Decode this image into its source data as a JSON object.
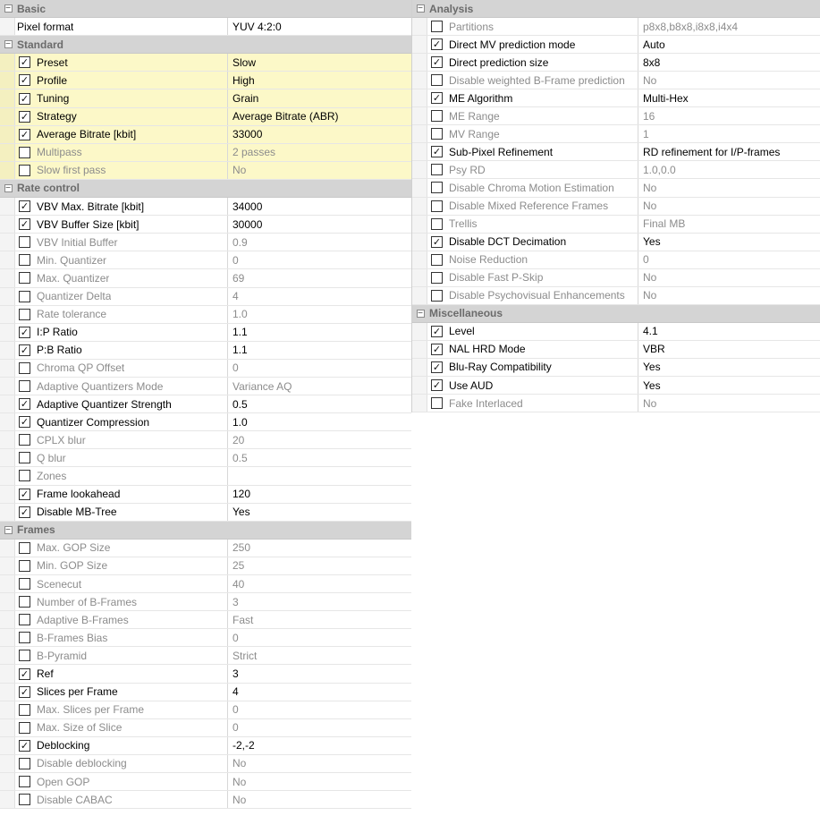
{
  "check_mark": "✓",
  "collapse_glyph": "−",
  "left": {
    "categories": [
      {
        "name": "Basic",
        "rows": [
          {
            "label": "Pixel format",
            "value": "YUV 4:2:0",
            "checkbox": false,
            "checked": false,
            "enabled": true,
            "highlight": false,
            "plain": true
          }
        ]
      },
      {
        "name": "Standard",
        "rows": [
          {
            "label": "Preset",
            "value": "Slow",
            "checkbox": true,
            "checked": true,
            "enabled": true,
            "highlight": true
          },
          {
            "label": "Profile",
            "value": "High",
            "checkbox": true,
            "checked": true,
            "enabled": true,
            "highlight": true
          },
          {
            "label": "Tuning",
            "value": "Grain",
            "checkbox": true,
            "checked": true,
            "enabled": true,
            "highlight": true
          },
          {
            "label": "Strategy",
            "value": "Average Bitrate (ABR)",
            "checkbox": true,
            "checked": true,
            "enabled": true,
            "highlight": true
          },
          {
            "label": "Average Bitrate [kbit]",
            "value": "33000",
            "checkbox": true,
            "checked": true,
            "enabled": true,
            "highlight": true
          },
          {
            "label": "Multipass",
            "value": "2 passes",
            "checkbox": true,
            "checked": false,
            "enabled": false,
            "highlight": true
          },
          {
            "label": "Slow first pass",
            "value": "No",
            "checkbox": true,
            "checked": false,
            "enabled": false,
            "highlight": true
          }
        ]
      },
      {
        "name": "Rate control",
        "rows": [
          {
            "label": "VBV Max. Bitrate [kbit]",
            "value": "34000",
            "checkbox": true,
            "checked": true,
            "enabled": true,
            "highlight": false
          },
          {
            "label": "VBV Buffer Size [kbit]",
            "value": "30000",
            "checkbox": true,
            "checked": true,
            "enabled": true,
            "highlight": false
          },
          {
            "label": "VBV Initial Buffer",
            "value": "0.9",
            "checkbox": true,
            "checked": false,
            "enabled": false,
            "highlight": false
          },
          {
            "label": "Min. Quantizer",
            "value": "0",
            "checkbox": true,
            "checked": false,
            "enabled": false,
            "highlight": false
          },
          {
            "label": "Max. Quantizer",
            "value": "69",
            "checkbox": true,
            "checked": false,
            "enabled": false,
            "highlight": false
          },
          {
            "label": "Quantizer Delta",
            "value": "4",
            "checkbox": true,
            "checked": false,
            "enabled": false,
            "highlight": false
          },
          {
            "label": "Rate tolerance",
            "value": "1.0",
            "checkbox": true,
            "checked": false,
            "enabled": false,
            "highlight": false
          },
          {
            "label": "I:P Ratio",
            "value": "1.1",
            "checkbox": true,
            "checked": true,
            "enabled": true,
            "highlight": false
          },
          {
            "label": "P:B Ratio",
            "value": "1.1",
            "checkbox": true,
            "checked": true,
            "enabled": true,
            "highlight": false
          },
          {
            "label": "Chroma QP Offset",
            "value": "0",
            "checkbox": true,
            "checked": false,
            "enabled": false,
            "highlight": false
          },
          {
            "label": "Adaptive Quantizers Mode",
            "value": "Variance AQ",
            "checkbox": true,
            "checked": false,
            "enabled": false,
            "highlight": false
          },
          {
            "label": "Adaptive Quantizer Strength",
            "value": "0.5",
            "checkbox": true,
            "checked": true,
            "enabled": true,
            "highlight": false
          },
          {
            "label": "Quantizer Compression",
            "value": "1.0",
            "checkbox": true,
            "checked": true,
            "enabled": true,
            "highlight": false
          },
          {
            "label": "CPLX blur",
            "value": "20",
            "checkbox": true,
            "checked": false,
            "enabled": false,
            "highlight": false
          },
          {
            "label": "Q blur",
            "value": "0.5",
            "checkbox": true,
            "checked": false,
            "enabled": false,
            "highlight": false
          },
          {
            "label": "Zones",
            "value": "",
            "checkbox": true,
            "checked": false,
            "enabled": false,
            "highlight": false
          },
          {
            "label": "Frame lookahead",
            "value": "120",
            "checkbox": true,
            "checked": true,
            "enabled": true,
            "highlight": false
          },
          {
            "label": "Disable MB-Tree",
            "value": "Yes",
            "checkbox": true,
            "checked": true,
            "enabled": true,
            "highlight": false
          }
        ]
      },
      {
        "name": "Frames",
        "rows": [
          {
            "label": "Max. GOP Size",
            "value": "250",
            "checkbox": true,
            "checked": false,
            "enabled": false,
            "highlight": false
          },
          {
            "label": "Min. GOP Size",
            "value": "25",
            "checkbox": true,
            "checked": false,
            "enabled": false,
            "highlight": false
          },
          {
            "label": "Scenecut",
            "value": "40",
            "checkbox": true,
            "checked": false,
            "enabled": false,
            "highlight": false
          },
          {
            "label": "Number of B-Frames",
            "value": "3",
            "checkbox": true,
            "checked": false,
            "enabled": false,
            "highlight": false
          },
          {
            "label": "Adaptive B-Frames",
            "value": "Fast",
            "checkbox": true,
            "checked": false,
            "enabled": false,
            "highlight": false
          },
          {
            "label": "B-Frames Bias",
            "value": "0",
            "checkbox": true,
            "checked": false,
            "enabled": false,
            "highlight": false
          },
          {
            "label": "B-Pyramid",
            "value": "Strict",
            "checkbox": true,
            "checked": false,
            "enabled": false,
            "highlight": false
          },
          {
            "label": "Ref",
            "value": "3",
            "checkbox": true,
            "checked": true,
            "enabled": true,
            "highlight": false
          },
          {
            "label": "Slices per Frame",
            "value": "4",
            "checkbox": true,
            "checked": true,
            "enabled": true,
            "highlight": false
          },
          {
            "label": "Max. Slices per Frame",
            "value": "0",
            "checkbox": true,
            "checked": false,
            "enabled": false,
            "highlight": false
          },
          {
            "label": "Max. Size of Slice",
            "value": "0",
            "checkbox": true,
            "checked": false,
            "enabled": false,
            "highlight": false
          },
          {
            "label": "Deblocking",
            "value": "-2,-2",
            "checkbox": true,
            "checked": true,
            "enabled": true,
            "highlight": false
          },
          {
            "label": "Disable deblocking",
            "value": "No",
            "checkbox": true,
            "checked": false,
            "enabled": false,
            "highlight": false
          },
          {
            "label": "Open GOP",
            "value": "No",
            "checkbox": true,
            "checked": false,
            "enabled": false,
            "highlight": false
          },
          {
            "label": "Disable CABAC",
            "value": "No",
            "checkbox": true,
            "checked": false,
            "enabled": false,
            "highlight": false
          }
        ]
      }
    ]
  },
  "right": {
    "categories": [
      {
        "name": "Analysis",
        "rows": [
          {
            "label": "Partitions",
            "value": "p8x8,b8x8,i8x8,i4x4",
            "checkbox": true,
            "checked": false,
            "enabled": false,
            "highlight": false
          },
          {
            "label": "Direct MV prediction mode",
            "value": "Auto",
            "checkbox": true,
            "checked": true,
            "enabled": true,
            "highlight": false
          },
          {
            "label": "Direct prediction size",
            "value": "8x8",
            "checkbox": true,
            "checked": true,
            "enabled": true,
            "highlight": false
          },
          {
            "label": "Disable weighted B-Frame prediction",
            "value": "No",
            "checkbox": true,
            "checked": false,
            "enabled": false,
            "highlight": false
          },
          {
            "label": "ME Algorithm",
            "value": "Multi-Hex",
            "checkbox": true,
            "checked": true,
            "enabled": true,
            "highlight": false
          },
          {
            "label": "ME Range",
            "value": "16",
            "checkbox": true,
            "checked": false,
            "enabled": false,
            "highlight": false
          },
          {
            "label": "MV Range",
            "value": "1",
            "checkbox": true,
            "checked": false,
            "enabled": false,
            "highlight": false
          },
          {
            "label": "Sub-Pixel Refinement",
            "value": "RD refinement for I/P-frames",
            "checkbox": true,
            "checked": true,
            "enabled": true,
            "highlight": false
          },
          {
            "label": "Psy RD",
            "value": "1.0,0.0",
            "checkbox": true,
            "checked": false,
            "enabled": false,
            "highlight": false
          },
          {
            "label": "Disable Chroma Motion Estimation",
            "value": "No",
            "checkbox": true,
            "checked": false,
            "enabled": false,
            "highlight": false
          },
          {
            "label": "Disable Mixed Reference Frames",
            "value": "No",
            "checkbox": true,
            "checked": false,
            "enabled": false,
            "highlight": false
          },
          {
            "label": "Trellis",
            "value": "Final MB",
            "checkbox": true,
            "checked": false,
            "enabled": false,
            "highlight": false
          },
          {
            "label": "Disable DCT Decimation",
            "value": "Yes",
            "checkbox": true,
            "checked": true,
            "enabled": true,
            "highlight": false
          },
          {
            "label": "Noise Reduction",
            "value": "0",
            "checkbox": true,
            "checked": false,
            "enabled": false,
            "highlight": false
          },
          {
            "label": "Disable Fast P-Skip",
            "value": "No",
            "checkbox": true,
            "checked": false,
            "enabled": false,
            "highlight": false
          },
          {
            "label": "Disable Psychovisual Enhancements",
            "value": "No",
            "checkbox": true,
            "checked": false,
            "enabled": false,
            "highlight": false
          }
        ]
      },
      {
        "name": "Miscellaneous",
        "rows": [
          {
            "label": "Level",
            "value": "4.1",
            "checkbox": true,
            "checked": true,
            "enabled": true,
            "highlight": false
          },
          {
            "label": "NAL HRD Mode",
            "value": "VBR",
            "checkbox": true,
            "checked": true,
            "enabled": true,
            "highlight": false
          },
          {
            "label": "Blu-Ray Compatibility",
            "value": "Yes",
            "checkbox": true,
            "checked": true,
            "enabled": true,
            "highlight": false
          },
          {
            "label": "Use AUD",
            "value": "Yes",
            "checkbox": true,
            "checked": true,
            "enabled": true,
            "highlight": false
          },
          {
            "label": "Fake Interlaced",
            "value": "No",
            "checkbox": true,
            "checked": false,
            "enabled": false,
            "highlight": false
          }
        ]
      }
    ]
  }
}
